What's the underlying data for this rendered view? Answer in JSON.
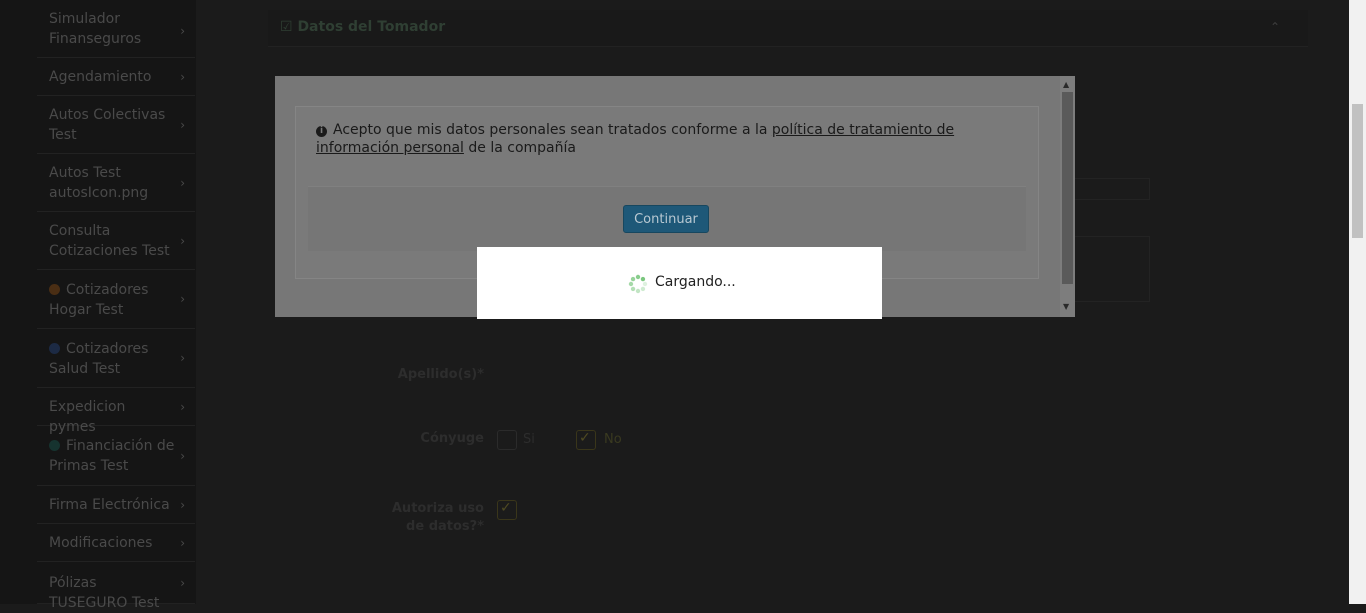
{
  "sidebar": {
    "items": [
      {
        "label": "Simulador Finanseguros",
        "icon": null
      },
      {
        "label": "Agendamiento",
        "icon": null
      },
      {
        "label": "Autos Colectivas Test",
        "icon": null
      },
      {
        "label": "Autos Test autosIcon.png",
        "icon": null
      },
      {
        "label": "Consulta Cotizaciones Test",
        "icon": null
      },
      {
        "label": "Cotizadores Hogar Test",
        "icon": "orange-circle-icon",
        "icon_color": "#4a2e14"
      },
      {
        "label": "Cotizadores Salud Test",
        "icon": "blue-circle-icon",
        "icon_color": "#1c2a44"
      },
      {
        "label": "Expedicion pymes",
        "icon": null
      },
      {
        "label": "Financiación de Primas Test",
        "icon": "teal-circle-icon",
        "icon_color": "#16332f"
      },
      {
        "label": "Firma Electrónica",
        "icon": null
      },
      {
        "label": "Modificaciones",
        "icon": null
      },
      {
        "label": "Pólizas TUSEGURO Test",
        "icon": null
      }
    ],
    "chevron": "›"
  },
  "panel": {
    "title": "Datos del Tomador",
    "title_icon": "edit-check-icon"
  },
  "form": {
    "apellido_label": "Apellido(s)*",
    "conyuge_label": "Cónyuge",
    "conyuge_options": [
      "Si",
      "No"
    ],
    "conyuge_selected": "No",
    "autoriza_label": "Autoriza uso de datos?*",
    "autoriza_checked": true
  },
  "modal": {
    "consent_prefix": "Acepto que mis datos personales sean tratados conforme a la ",
    "consent_link": "política de tratamiento de información personal",
    "consent_suffix": " de la compañía",
    "continue_button": "Continuar"
  },
  "loading": {
    "text": "Cargando..."
  },
  "colors": {
    "accent_button": "#337ab7",
    "spinner": "#7bc77f"
  }
}
